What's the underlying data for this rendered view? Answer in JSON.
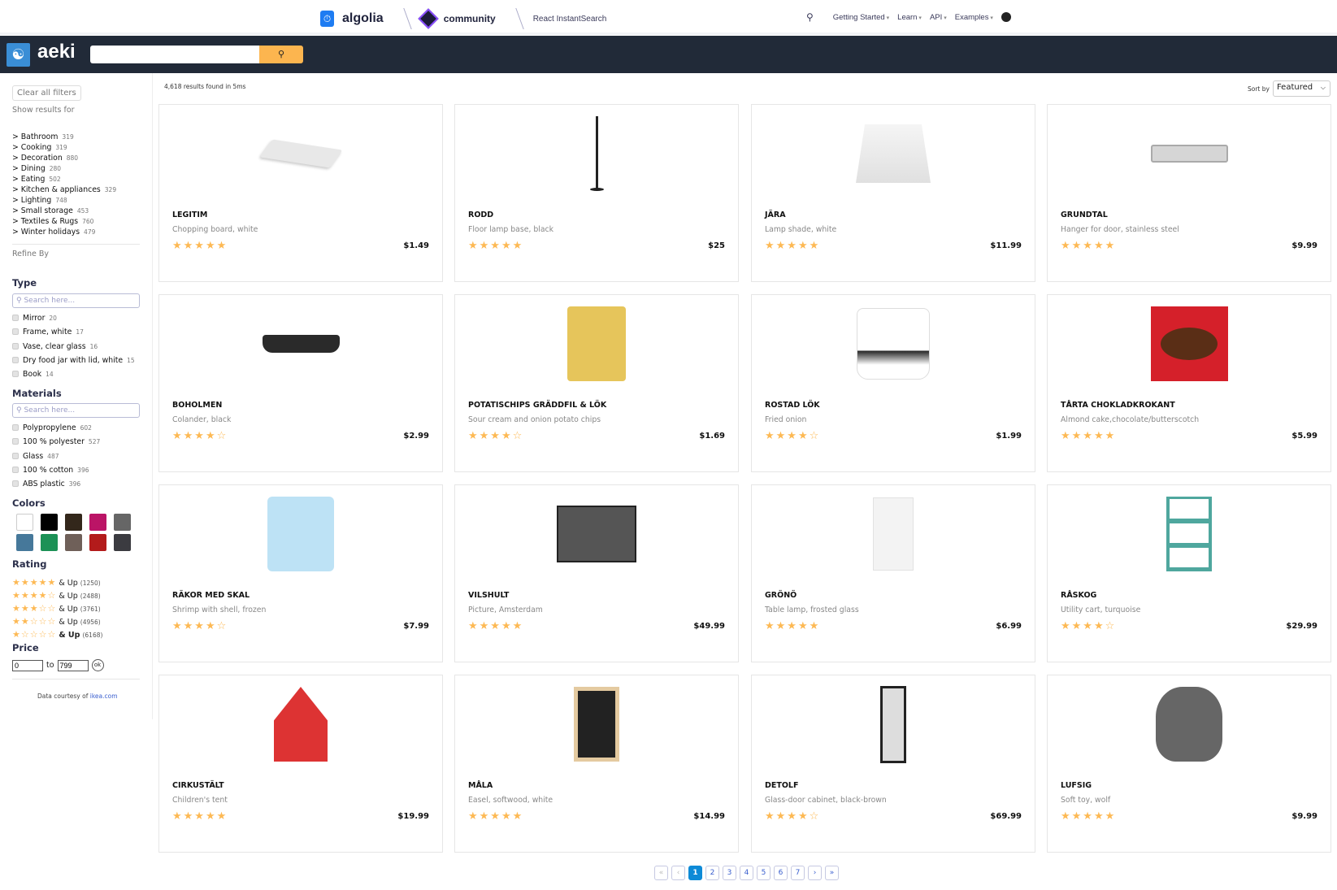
{
  "topbar": {
    "brand": "algolia",
    "community": "community",
    "product": "React InstantSearch",
    "nav": [
      "Getting Started",
      "Learn",
      "API",
      "Examples"
    ]
  },
  "header": {
    "brand": "aeki",
    "search_value": ""
  },
  "sidebar": {
    "clear_label": "Clear all filters",
    "show_results_for": "Show results for",
    "categories": [
      {
        "label": "Bathroom",
        "count": "319"
      },
      {
        "label": "Cooking",
        "count": "319"
      },
      {
        "label": "Decoration",
        "count": "880"
      },
      {
        "label": "Dining",
        "count": "280"
      },
      {
        "label": "Eating",
        "count": "502"
      },
      {
        "label": "Kitchen & appliances",
        "count": "329"
      },
      {
        "label": "Lighting",
        "count": "748"
      },
      {
        "label": "Small storage",
        "count": "453"
      },
      {
        "label": "Textiles & Rugs",
        "count": "760"
      },
      {
        "label": "Winter holidays",
        "count": "479"
      }
    ],
    "refine_by": "Refine By",
    "type": {
      "title": "Type",
      "placeholder": "Search here...",
      "items": [
        {
          "label": "Mirror",
          "count": "20"
        },
        {
          "label": "Frame, white",
          "count": "17"
        },
        {
          "label": "Vase, clear glass",
          "count": "16"
        },
        {
          "label": "Dry food jar with lid, white",
          "count": "15"
        },
        {
          "label": "Book",
          "count": "14"
        }
      ]
    },
    "materials": {
      "title": "Materials",
      "placeholder": "Search here...",
      "items": [
        {
          "label": "Polypropylene",
          "count": "602"
        },
        {
          "label": "100 % polyester",
          "count": "527"
        },
        {
          "label": "Glass",
          "count": "487"
        },
        {
          "label": "100 % cotton",
          "count": "396"
        },
        {
          "label": "ABS plastic",
          "count": "396"
        }
      ]
    },
    "colors": {
      "title": "Colors",
      "swatches": [
        "#ffffff",
        "#000000",
        "#33271b",
        "#bb1466",
        "#666666",
        "#46789a",
        "#1c9156",
        "#6f6059",
        "#b31b1b",
        "#3b3b40"
      ]
    },
    "rating": {
      "title": "Rating",
      "and_up": "& Up",
      "items": [
        {
          "stars": 5,
          "count": "(1250)"
        },
        {
          "stars": 4,
          "count": "(2488)"
        },
        {
          "stars": 3,
          "count": "(3761)"
        },
        {
          "stars": 2,
          "count": "(4956)"
        },
        {
          "stars": 1,
          "count": "(6168)"
        }
      ]
    },
    "price": {
      "title": "Price",
      "min": "0",
      "to": "to",
      "max": "799",
      "ok": "ok"
    },
    "credit_prefix": "Data courtesy of",
    "credit_link": "ikea.com"
  },
  "results": {
    "count_text": "4,618 results found in 5ms",
    "sort_label": "Sort by",
    "sort_value": "Featured"
  },
  "products": [
    {
      "name": "LEGITIM",
      "desc": "Chopping board, white",
      "price": "$1.49",
      "rating": 5
    },
    {
      "name": "RODD",
      "desc": "Floor lamp base, black",
      "price": "$25",
      "rating": 5
    },
    {
      "name": "JÄRA",
      "desc": "Lamp shade, white",
      "price": "$11.99",
      "rating": 5
    },
    {
      "name": "GRUNDTAL",
      "desc": "Hanger for door, stainless steel",
      "price": "$9.99",
      "rating": 5
    },
    {
      "name": "BOHOLMEN",
      "desc": "Colander, black",
      "price": "$2.99",
      "rating": 4
    },
    {
      "name": "POTATISCHIPS GRÄDDFIL & LÖK",
      "desc": "Sour cream and onion potato chips",
      "price": "$1.69",
      "rating": 4
    },
    {
      "name": "ROSTAD LÖK",
      "desc": "Fried onion",
      "price": "$1.99",
      "rating": 4
    },
    {
      "name": "TÅRTA CHOKLADKROKANT",
      "desc": "Almond cake,chocolate/butterscotch",
      "price": "$5.99",
      "rating": 5
    },
    {
      "name": "RÄKOR MED SKAL",
      "desc": "Shrimp with shell, frozen",
      "price": "$7.99",
      "rating": 4
    },
    {
      "name": "VILSHULT",
      "desc": "Picture, Amsterdam",
      "price": "$49.99",
      "rating": 5
    },
    {
      "name": "GRÖNÖ",
      "desc": "Table lamp, frosted glass",
      "price": "$6.99",
      "rating": 5
    },
    {
      "name": "RÅSKOG",
      "desc": "Utility cart, turquoise",
      "price": "$29.99",
      "rating": 4
    },
    {
      "name": "CIRKUSTÄLT",
      "desc": "Children's tent",
      "price": "$19.99",
      "rating": 5
    },
    {
      "name": "MÅLA",
      "desc": "Easel, softwood, white",
      "price": "$14.99",
      "rating": 5
    },
    {
      "name": "DETOLF",
      "desc": "Glass-door cabinet, black-brown",
      "price": "$69.99",
      "rating": 4
    },
    {
      "name": "LUFSIG",
      "desc": "Soft toy, wolf",
      "price": "$9.99",
      "rating": 5
    }
  ],
  "pagination": {
    "first": "«",
    "prev": "‹",
    "pages": [
      "1",
      "2",
      "3",
      "4",
      "5",
      "6",
      "7"
    ],
    "current": "1",
    "next": "›",
    "last": "»"
  },
  "accent": "#fcb54f"
}
